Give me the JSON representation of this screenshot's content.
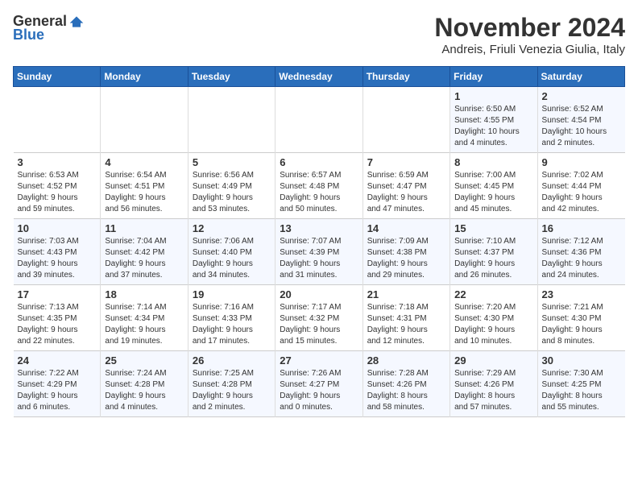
{
  "logo": {
    "general": "General",
    "blue": "Blue"
  },
  "title": "November 2024",
  "subtitle": "Andreis, Friuli Venezia Giulia, Italy",
  "days_of_week": [
    "Sunday",
    "Monday",
    "Tuesday",
    "Wednesday",
    "Thursday",
    "Friday",
    "Saturday"
  ],
  "weeks": [
    [
      {
        "day": "",
        "info": ""
      },
      {
        "day": "",
        "info": ""
      },
      {
        "day": "",
        "info": ""
      },
      {
        "day": "",
        "info": ""
      },
      {
        "day": "",
        "info": ""
      },
      {
        "day": "1",
        "info": "Sunrise: 6:50 AM\nSunset: 4:55 PM\nDaylight: 10 hours\nand 4 minutes."
      },
      {
        "day": "2",
        "info": "Sunrise: 6:52 AM\nSunset: 4:54 PM\nDaylight: 10 hours\nand 2 minutes."
      }
    ],
    [
      {
        "day": "3",
        "info": "Sunrise: 6:53 AM\nSunset: 4:52 PM\nDaylight: 9 hours\nand 59 minutes."
      },
      {
        "day": "4",
        "info": "Sunrise: 6:54 AM\nSunset: 4:51 PM\nDaylight: 9 hours\nand 56 minutes."
      },
      {
        "day": "5",
        "info": "Sunrise: 6:56 AM\nSunset: 4:49 PM\nDaylight: 9 hours\nand 53 minutes."
      },
      {
        "day": "6",
        "info": "Sunrise: 6:57 AM\nSunset: 4:48 PM\nDaylight: 9 hours\nand 50 minutes."
      },
      {
        "day": "7",
        "info": "Sunrise: 6:59 AM\nSunset: 4:47 PM\nDaylight: 9 hours\nand 47 minutes."
      },
      {
        "day": "8",
        "info": "Sunrise: 7:00 AM\nSunset: 4:45 PM\nDaylight: 9 hours\nand 45 minutes."
      },
      {
        "day": "9",
        "info": "Sunrise: 7:02 AM\nSunset: 4:44 PM\nDaylight: 9 hours\nand 42 minutes."
      }
    ],
    [
      {
        "day": "10",
        "info": "Sunrise: 7:03 AM\nSunset: 4:43 PM\nDaylight: 9 hours\nand 39 minutes."
      },
      {
        "day": "11",
        "info": "Sunrise: 7:04 AM\nSunset: 4:42 PM\nDaylight: 9 hours\nand 37 minutes."
      },
      {
        "day": "12",
        "info": "Sunrise: 7:06 AM\nSunset: 4:40 PM\nDaylight: 9 hours\nand 34 minutes."
      },
      {
        "day": "13",
        "info": "Sunrise: 7:07 AM\nSunset: 4:39 PM\nDaylight: 9 hours\nand 31 minutes."
      },
      {
        "day": "14",
        "info": "Sunrise: 7:09 AM\nSunset: 4:38 PM\nDaylight: 9 hours\nand 29 minutes."
      },
      {
        "day": "15",
        "info": "Sunrise: 7:10 AM\nSunset: 4:37 PM\nDaylight: 9 hours\nand 26 minutes."
      },
      {
        "day": "16",
        "info": "Sunrise: 7:12 AM\nSunset: 4:36 PM\nDaylight: 9 hours\nand 24 minutes."
      }
    ],
    [
      {
        "day": "17",
        "info": "Sunrise: 7:13 AM\nSunset: 4:35 PM\nDaylight: 9 hours\nand 22 minutes."
      },
      {
        "day": "18",
        "info": "Sunrise: 7:14 AM\nSunset: 4:34 PM\nDaylight: 9 hours\nand 19 minutes."
      },
      {
        "day": "19",
        "info": "Sunrise: 7:16 AM\nSunset: 4:33 PM\nDaylight: 9 hours\nand 17 minutes."
      },
      {
        "day": "20",
        "info": "Sunrise: 7:17 AM\nSunset: 4:32 PM\nDaylight: 9 hours\nand 15 minutes."
      },
      {
        "day": "21",
        "info": "Sunrise: 7:18 AM\nSunset: 4:31 PM\nDaylight: 9 hours\nand 12 minutes."
      },
      {
        "day": "22",
        "info": "Sunrise: 7:20 AM\nSunset: 4:30 PM\nDaylight: 9 hours\nand 10 minutes."
      },
      {
        "day": "23",
        "info": "Sunrise: 7:21 AM\nSunset: 4:30 PM\nDaylight: 9 hours\nand 8 minutes."
      }
    ],
    [
      {
        "day": "24",
        "info": "Sunrise: 7:22 AM\nSunset: 4:29 PM\nDaylight: 9 hours\nand 6 minutes."
      },
      {
        "day": "25",
        "info": "Sunrise: 7:24 AM\nSunset: 4:28 PM\nDaylight: 9 hours\nand 4 minutes."
      },
      {
        "day": "26",
        "info": "Sunrise: 7:25 AM\nSunset: 4:28 PM\nDaylight: 9 hours\nand 2 minutes."
      },
      {
        "day": "27",
        "info": "Sunrise: 7:26 AM\nSunset: 4:27 PM\nDaylight: 9 hours\nand 0 minutes."
      },
      {
        "day": "28",
        "info": "Sunrise: 7:28 AM\nSunset: 4:26 PM\nDaylight: 8 hours\nand 58 minutes."
      },
      {
        "day": "29",
        "info": "Sunrise: 7:29 AM\nSunset: 4:26 PM\nDaylight: 8 hours\nand 57 minutes."
      },
      {
        "day": "30",
        "info": "Sunrise: 7:30 AM\nSunset: 4:25 PM\nDaylight: 8 hours\nand 55 minutes."
      }
    ]
  ]
}
